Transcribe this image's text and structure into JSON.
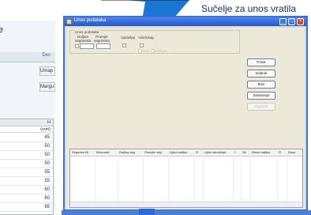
{
  "caption": "Sučelje za unos vratila",
  "background_window": {
    "title": "e",
    "header_right": "Dev",
    "side_buttons": [
      "Umap",
      "Margu"
    ],
    "table": {
      "header": "H",
      "subheader": "(mm)",
      "rows": [
        "45",
        "50",
        "50",
        "50",
        "55",
        "55",
        "60",
        "60",
        "65"
      ]
    }
  },
  "dialog": {
    "title": "Unos podataka",
    "controls": {
      "minimize": "_",
      "maximize": "□",
      "close": "×"
    },
    "group": {
      "label": "Unos podataka",
      "field1_label": "Duljina segmenta",
      "field2_label": "Promjer segmenta",
      "field3_label": "Upravljaj",
      "field4_label": "Utor/Utog",
      "radio1_label": "Naz",
      "radio2_label": "Izdrzan"
    },
    "buttons": [
      "Potok",
      "Izdanie",
      "Brisi",
      "Zatvaranje",
      "Zapamti"
    ],
    "grid": {
      "columns": [
        "Segment Br",
        "Br/umant",
        "Duljina seg",
        "Promjer seg",
        "Lijevi radijus",
        "R",
        "Lijevi skrošenje",
        "l",
        "Sir",
        "Desni radijus",
        "R",
        "Desn"
      ]
    }
  }
}
